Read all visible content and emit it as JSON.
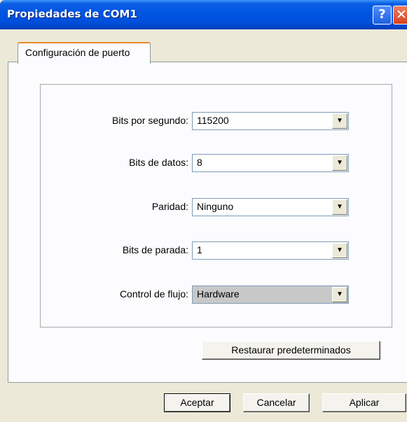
{
  "window": {
    "title": "Propiedades de COM1",
    "help_glyph": "?",
    "close_glyph": "✕"
  },
  "tabs": [
    {
      "label": "Configuración de puerto"
    }
  ],
  "settings": [
    {
      "label": "Bits por segundo:",
      "value": "115200"
    },
    {
      "label": "Bits de datos:",
      "value": "8"
    },
    {
      "label": "Paridad:",
      "value": "Ninguno"
    },
    {
      "label": "Bits de parada:",
      "value": "1"
    },
    {
      "label": "Control de flujo:",
      "value": "Hardware"
    }
  ],
  "buttons": {
    "restore": "Restaurar predeterminados",
    "ok": "Aceptar",
    "cancel": "Cancelar",
    "apply": "Aplicar"
  },
  "colors": {
    "titlebar": "#0054e3",
    "tab_highlight": "#e68b2c",
    "close_button": "#d7401d"
  }
}
